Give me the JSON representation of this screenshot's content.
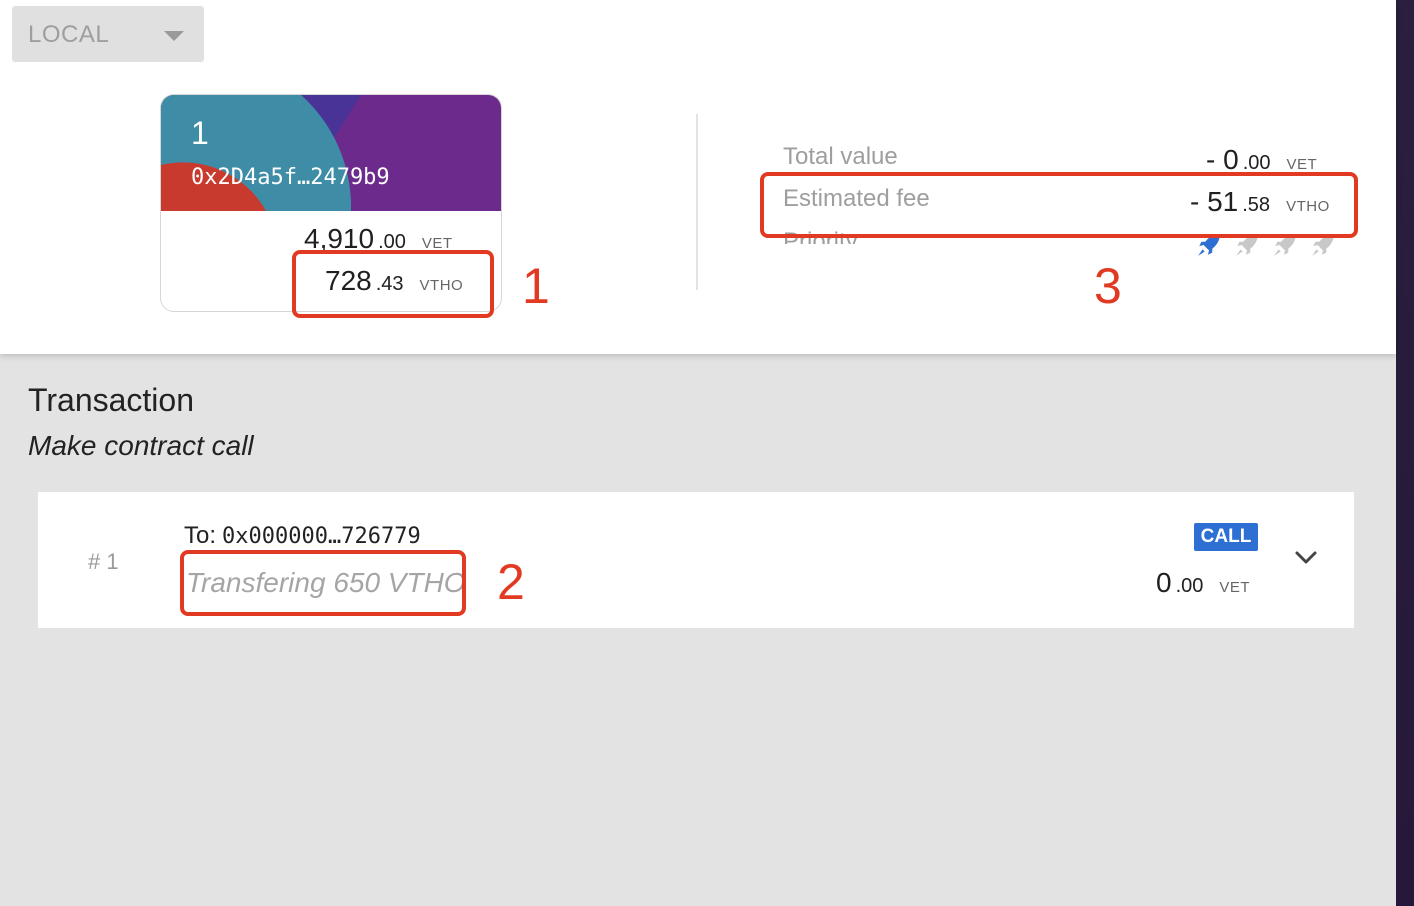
{
  "network": {
    "label": "LOCAL"
  },
  "wallet": {
    "index": "1",
    "address": "0x2D4a5f…2479b9",
    "vet_int": "4,910",
    "vet_dec": ".00",
    "vet_unit": "VET",
    "vtho_int": "728",
    "vtho_dec": ".43",
    "vtho_unit": "VTHO"
  },
  "summary": {
    "total_value_label": "Total value",
    "total_value_int": "- 0",
    "total_value_dec": ".00",
    "total_value_unit": "VET",
    "fee_label": "Estimated fee",
    "fee_int": "- 51",
    "fee_dec": ".58",
    "fee_unit": "VTHO",
    "priority_label": "Priority",
    "priority_level": 1,
    "priority_max": 4
  },
  "annotations": [
    "1",
    "2",
    "3"
  ],
  "transaction": {
    "title": "Transaction",
    "subtitle": "Make contract call",
    "clauses": [
      {
        "number": "# 1",
        "to_label": "To:",
        "to_address": "0x000000…726779",
        "comment": "Transfering 650 VTHO",
        "badge": "CALL",
        "value_int": "0",
        "value_dec": ".00",
        "value_unit": "VET"
      }
    ]
  },
  "colors": {
    "annotation_red": "#e23a22",
    "badge_blue": "#2d6fd2",
    "card_teal": "#3e8ca6",
    "card_purple": "#6b2a8c",
    "card_red": "#c93a2e",
    "priority_active": "#2d6fd2",
    "priority_inactive": "#c8c8c8"
  },
  "icons": {
    "network_dropdown": "chevron-down-icon",
    "priority": "rocket-icon",
    "expand": "chevron-down-icon"
  }
}
